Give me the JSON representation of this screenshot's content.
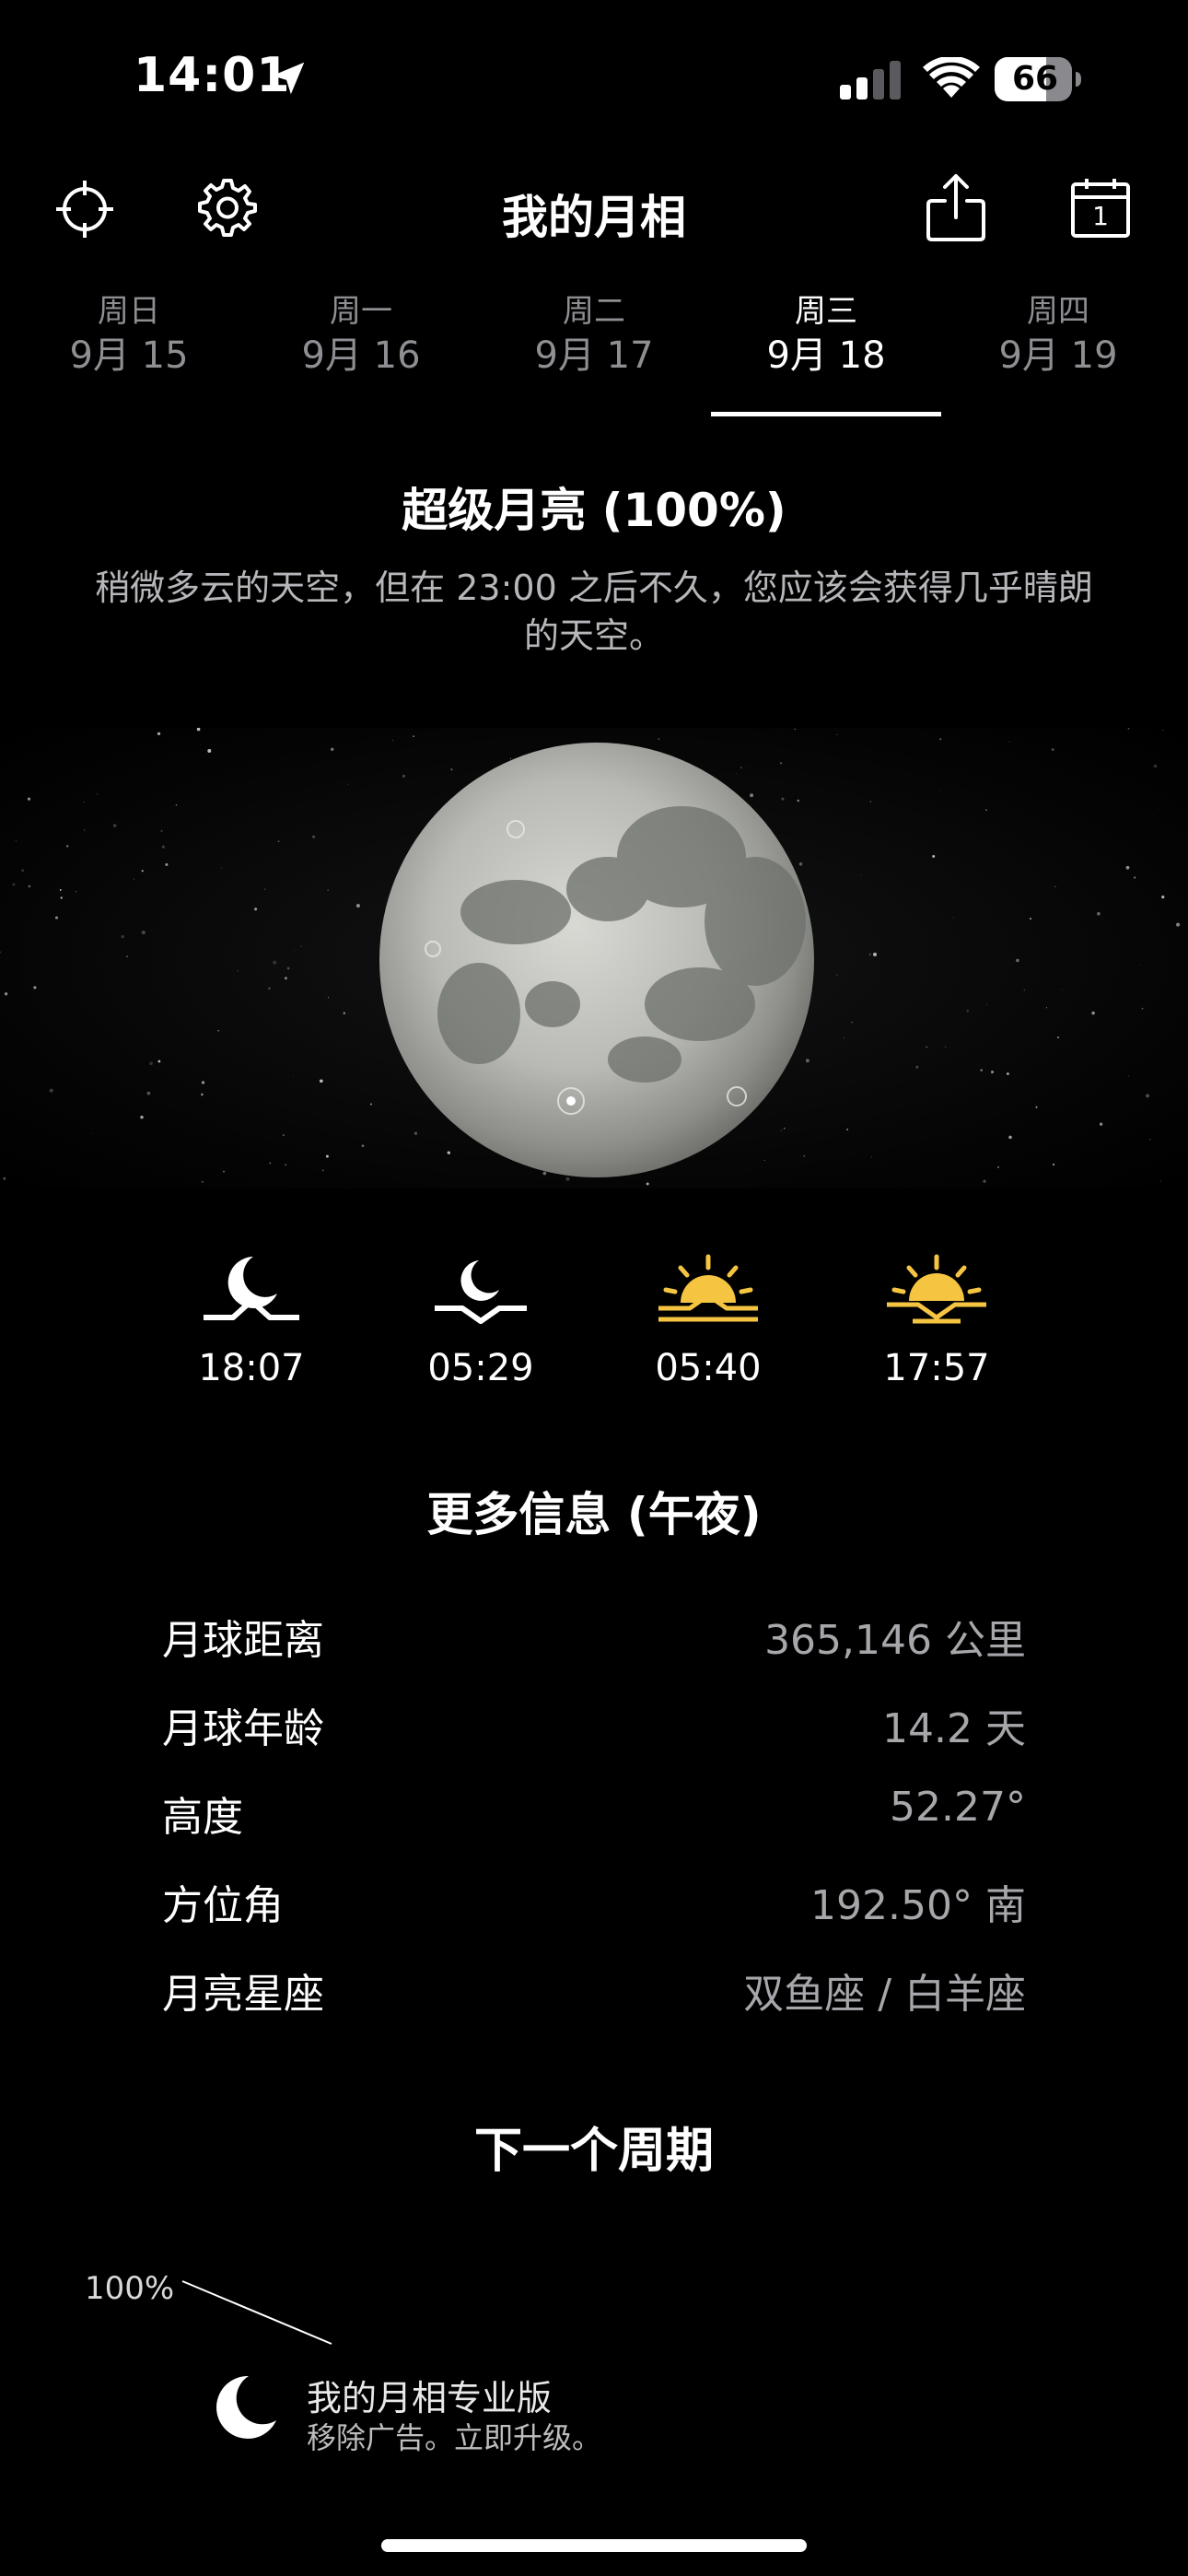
{
  "status_bar": {
    "time": "14:01",
    "battery": "66",
    "icons": [
      "location-arrow-icon",
      "cellular-signal-icon",
      "wifi-icon",
      "battery-icon"
    ]
  },
  "header": {
    "title": "我的月相",
    "icons": [
      "crosshair-icon",
      "gear-icon",
      "share-icon",
      "calendar-icon"
    ],
    "calendar_day": "1"
  },
  "tabs": [
    {
      "day": "周日",
      "date": "9月 15"
    },
    {
      "day": "周一",
      "date": "9月 16"
    },
    {
      "day": "周二",
      "date": "9月 17"
    },
    {
      "day": "周三",
      "date": "9月 18"
    },
    {
      "day": "周四",
      "date": "9月 19"
    }
  ],
  "active_tab_index": 3,
  "phase": {
    "title": "超级月亮 (100%)",
    "forecast": "稍微多云的天空，但在 23:00 之后不久，您应该会获得几乎晴朗的天空。"
  },
  "rise_set": [
    {
      "icon": "moonrise-icon",
      "time": "18:07",
      "color": "#ffffff"
    },
    {
      "icon": "moonset-icon",
      "time": "05:29",
      "color": "#ffffff"
    },
    {
      "icon": "sunrise-icon",
      "time": "05:40",
      "color": "#f5c542"
    },
    {
      "icon": "sunset-icon",
      "time": "17:57",
      "color": "#f5c542"
    }
  ],
  "more_info": {
    "title": "更多信息 (午夜)",
    "rows": [
      {
        "label": "月球距离",
        "value": "365,146 公里"
      },
      {
        "label": "月球年龄",
        "value": "14.2 天"
      },
      {
        "label": "高度",
        "value": "52.27°"
      },
      {
        "label": "方位角",
        "value": "192.50° 南"
      },
      {
        "label": "月亮星座",
        "value": "双鱼座 / 白羊座"
      }
    ]
  },
  "next_cycle": {
    "title": "下一个周期",
    "percent_label": "100%"
  },
  "promo": {
    "title": "我的月相专业版",
    "subtitle": "移除广告。立即升级。"
  },
  "colors": {
    "background": "#000000",
    "sun_accent": "#f5c542",
    "inactive_tab": "#8e8e93"
  }
}
